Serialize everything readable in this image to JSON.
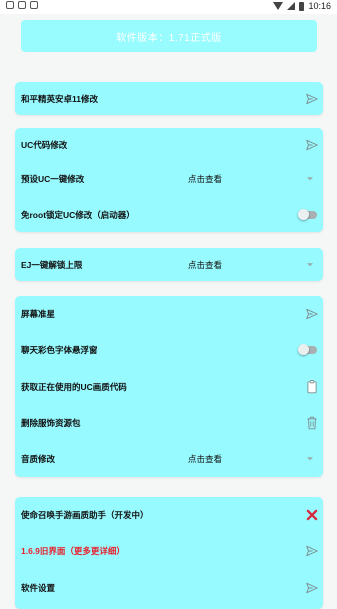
{
  "status_bar": {
    "time": "10:16"
  },
  "version_label": "软件版本：1.71正式版",
  "rows": {
    "r1": {
      "label": "和平精英安卓11修改",
      "icon": "send-icon"
    },
    "r2": {
      "label": "UC代码修改",
      "icon": "send-icon"
    },
    "r3": {
      "label": "预设UC一键修改",
      "value": "点击查看",
      "icon": "chevron-down-icon"
    },
    "r4": {
      "label": "免root锁定UC修改（启动器）",
      "toggle": false
    },
    "r5": {
      "label": "EJ一键解锁上限",
      "value": "点击查看",
      "icon": "chevron-down-icon"
    },
    "r6": {
      "label": "屏幕准星",
      "icon": "send-icon"
    },
    "r7": {
      "label": "聊天彩色字体悬浮窗",
      "toggle": false
    },
    "r8": {
      "label": "获取正在使用的UC画质代码",
      "icon": "clipboard-icon"
    },
    "r9": {
      "label": "删除服饰资源包",
      "icon": "trash-icon"
    },
    "r10": {
      "label": "音质修改",
      "value": "点击查看",
      "icon": "chevron-down-icon"
    },
    "r11": {
      "label": "使命召唤手游画质助手（开发中）",
      "icon": "close-icon",
      "icon_color": "#d8283f"
    },
    "r12": {
      "label": "1.6.9旧界面（更多更详细）",
      "label_color": "#e8202c",
      "icon": "send-icon"
    },
    "r13": {
      "label": "软件设置",
      "icon": "send-icon"
    }
  }
}
